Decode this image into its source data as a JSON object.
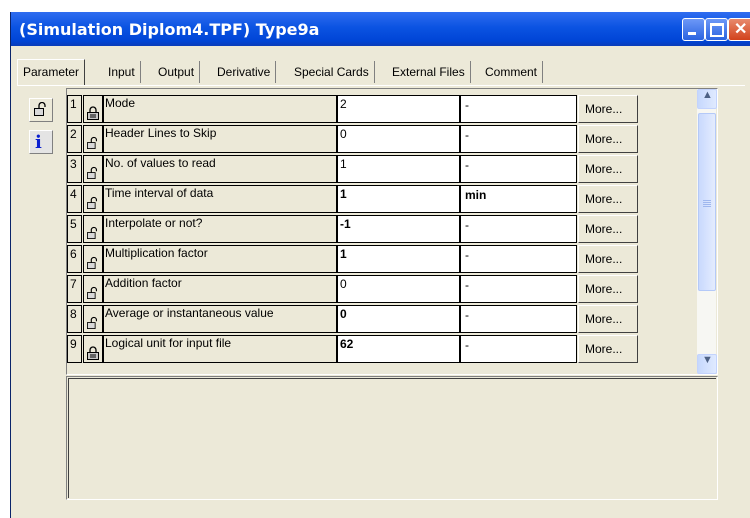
{
  "window": {
    "title": "(Simulation Diplom4.TPF) Type9a"
  },
  "tabs": [
    {
      "label": "Parameter",
      "active": true
    },
    {
      "label": "Input"
    },
    {
      "label": "Output"
    },
    {
      "label": "Derivative"
    },
    {
      "label": "Special Cards"
    },
    {
      "label": "External Files"
    },
    {
      "label": "Comment"
    }
  ],
  "side_buttons": {
    "lock_icon": "padlock-open-icon",
    "info_icon": "info-icon"
  },
  "parameters": {
    "more_label": "More...",
    "rows": [
      {
        "num": "1",
        "name": "Mode",
        "value": "2",
        "unit": "-",
        "locked": true,
        "bold": false
      },
      {
        "num": "2",
        "name": "Header Lines to Skip",
        "value": "0",
        "unit": "-",
        "locked": false,
        "bold": false
      },
      {
        "num": "3",
        "name": "No. of values to read",
        "value": "1",
        "unit": "-",
        "locked": false,
        "bold": false
      },
      {
        "num": "4",
        "name": "Time interval of data",
        "value": "1",
        "unit": "min",
        "locked": false,
        "bold": true
      },
      {
        "num": "5",
        "name": "Interpolate or not?",
        "value": "-1",
        "unit": "-",
        "locked": false,
        "bold": true
      },
      {
        "num": "6",
        "name": "Multiplication factor",
        "value": "1",
        "unit": "-",
        "locked": false,
        "bold": true
      },
      {
        "num": "7",
        "name": "Addition factor",
        "value": "0",
        "unit": "-",
        "locked": false,
        "bold": false
      },
      {
        "num": "8",
        "name": "Average or instantaneous value",
        "value": "0",
        "unit": "-",
        "locked": false,
        "bold": true
      },
      {
        "num": "9",
        "name": "Logical unit for input file",
        "value": "62",
        "unit": "-",
        "locked": true,
        "bold": true
      }
    ]
  },
  "description": {
    "text": ""
  },
  "colors": {
    "titlebar": "#0b53e2",
    "window_bg": "#ece9d8",
    "info_icon": "#0a1fd0"
  }
}
